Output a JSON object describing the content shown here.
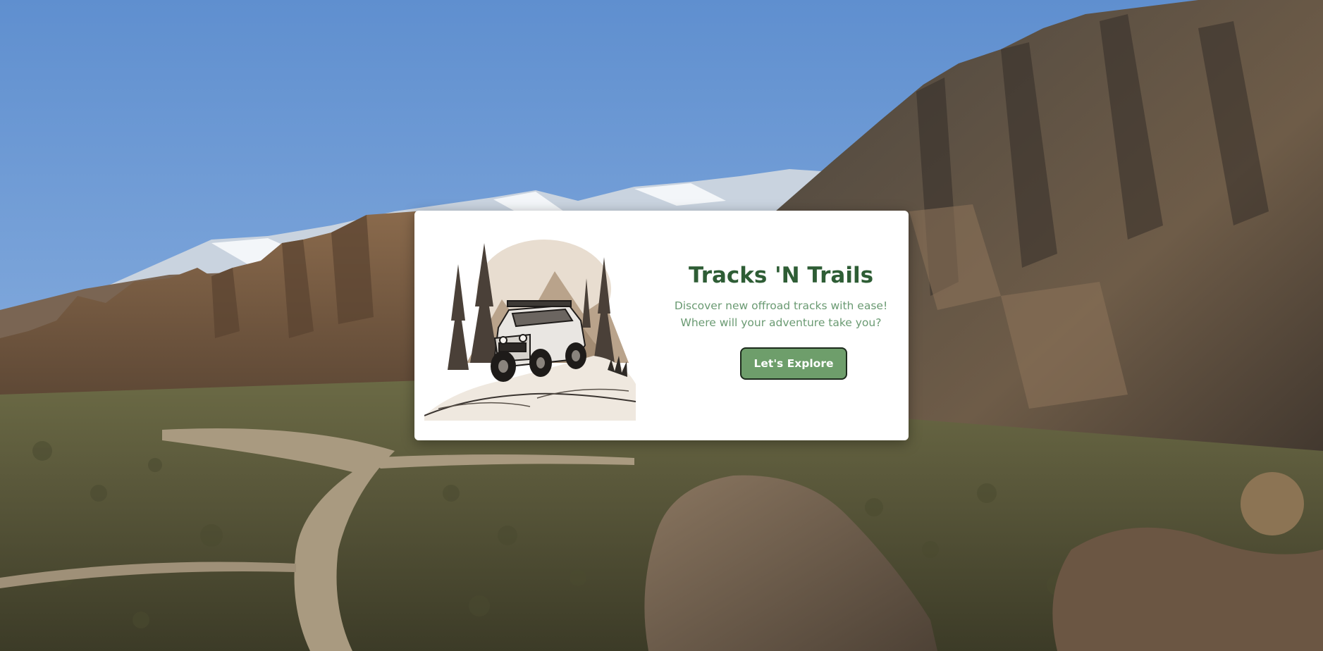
{
  "hero": {
    "title": "Tracks 'N Trails",
    "description_line1": "Discover new offroad tracks with ease!",
    "description_line2": "Where will your adventure take you?",
    "cta_label": "Let's Explore"
  },
  "colors": {
    "title": "#2e5d35",
    "description": "#6a9a72",
    "button_bg": "#6e9e6b",
    "button_border": "#1c2a1c",
    "card_bg": "#ffffff"
  },
  "icons": {
    "illustration": "offroad-jeep-illustration"
  }
}
